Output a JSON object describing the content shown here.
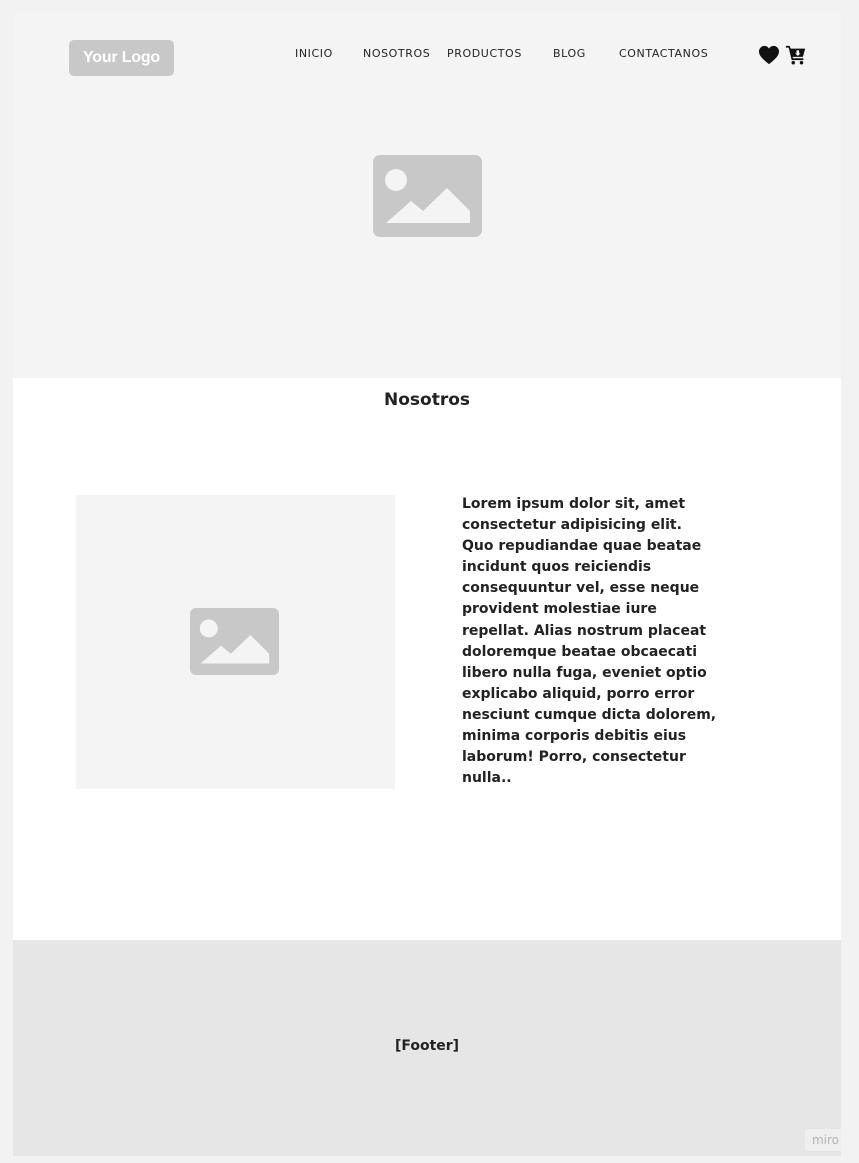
{
  "header": {
    "logo_text": "Your Logo",
    "nav": {
      "inicio": "INICIO",
      "nosotros": "NOSOTROS",
      "productos": "PRODUCTOS",
      "blog": "BLOG",
      "contactanos": "CONTACTANOS"
    },
    "icons": [
      "heart-icon",
      "cart-icon"
    ]
  },
  "hero": {
    "image_icon": "image-placeholder-icon"
  },
  "about": {
    "title": "Nosotros",
    "image_icon": "image-placeholder-icon",
    "body": "Lorem ipsum dolor sit, amet consectetur adipisicing elit. Quo repudiandae quae beatae incidunt quos reiciendis consequuntur vel, esse neque provident molestiae iure repellat. Alias nostrum placeat doloremque beatae obcaecati libero nulla fuga, eveniet optio explicabo aliquid, porro error nesciunt cumque dicta dolorem, minima corporis debitis eius laborum! Porro, consectetur nulla.."
  },
  "footer": {
    "label": "[Footer]"
  },
  "watermark": "miro",
  "colors": {
    "page_background": "#f2f2f2",
    "hero_background": "#f4f4f4",
    "footer_background": "#e6e6e6",
    "logo_background": "#c8c8c8",
    "placeholder_icon": "#c8c8c8",
    "text": "#222222"
  }
}
